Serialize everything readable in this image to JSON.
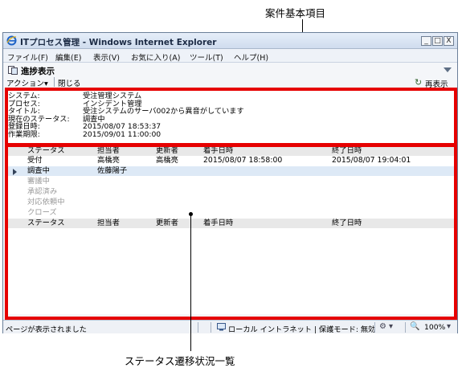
{
  "annotations": {
    "basic_items": "案件基本項目",
    "status_list": "ステータス遷移状況一覧"
  },
  "window": {
    "title": "ITプロセス管理 - Windows Internet Explorer",
    "controls": {
      "minimize": "_",
      "maximize": "□",
      "close": "X"
    }
  },
  "menu": [
    "ファイル(F)",
    "編集(E)",
    "表示(V)",
    "お気に入り(A)",
    "ツール(T)",
    "ヘルプ(H)"
  ],
  "app": {
    "title": "進捗表示",
    "action_menu": "アクション▾",
    "close_button": "閉じる",
    "refresh_button": "再表示"
  },
  "info": [
    {
      "label": "システム:",
      "value": "受注管理システム"
    },
    {
      "label": "プロセス:",
      "value": "インシデント管理"
    },
    {
      "label": "タイトル:",
      "value": "受注システムのサーバ002から異音がしています"
    },
    {
      "label": "現在のステータス:",
      "value": "調査中"
    },
    {
      "label": "登録日時:",
      "value": "2015/08/07 18:53:37"
    },
    {
      "label": "作業期限:",
      "value": "2015/09/01 11:00:00"
    }
  ],
  "table": {
    "columns": [
      "ステータス",
      "担当者",
      "更新者",
      "着手日時",
      "終了日時"
    ],
    "rows": [
      {
        "status": "受付",
        "assignee": "高橋亮",
        "updater": "高橋亮",
        "start": "2015/08/07 18:58:00",
        "end": "2015/08/07 19:04:01",
        "state": "done"
      },
      {
        "status": "調査中",
        "assignee": "佐藤陽子",
        "updater": "",
        "start": "",
        "end": "",
        "state": "current"
      },
      {
        "status": "審議中",
        "assignee": "",
        "updater": "",
        "start": "",
        "end": "",
        "state": "pending"
      },
      {
        "status": "承認済み",
        "assignee": "",
        "updater": "",
        "start": "",
        "end": "",
        "state": "pending"
      },
      {
        "status": "対応依頼中",
        "assignee": "",
        "updater": "",
        "start": "",
        "end": "",
        "state": "pending"
      },
      {
        "status": "クローズ",
        "assignee": "",
        "updater": "",
        "start": "",
        "end": "",
        "state": "pending"
      }
    ]
  },
  "statusbar": {
    "message": "ページが表示されました",
    "zone": "ローカル イントラネット | 保護モード: 無効",
    "zoom": "100%"
  },
  "colors": {
    "highlight_frame": "#e60000",
    "selected_row": "#dde9f6",
    "header_row": "#e8e8e8"
  }
}
